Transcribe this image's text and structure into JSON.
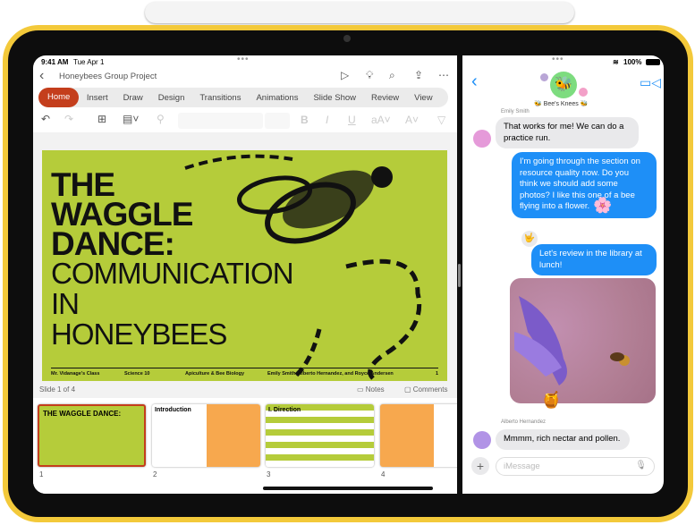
{
  "left_app": {
    "status_time": "9:41 AM",
    "status_date": "Tue Apr 1",
    "doc_title": "Honeybees Group Project",
    "tabs": [
      "Home",
      "Insert",
      "Draw",
      "Design",
      "Transitions",
      "Animations",
      "Slide Show",
      "Review",
      "View"
    ],
    "active_tab": "Home",
    "slide": {
      "title_bold": [
        "THE",
        "WAGGLE",
        "DANCE:"
      ],
      "title_thin": [
        "COMMUNICATION",
        "IN",
        "HONEYBEES"
      ],
      "footer": [
        "Mr. Vidanage's Class",
        "Science 10",
        "Apiculture & Bee Biology",
        "Emily Smith, Alberto Hernandez, and Royce Andersen",
        "1"
      ]
    },
    "slide_counter": "Slide 1 of 4",
    "notes_label": "Notes",
    "comments_label": "Comments",
    "thumbnails": [
      {
        "number": "1",
        "title": "THE WAGGLE DANCE:"
      },
      {
        "number": "2",
        "title": "Introduction"
      },
      {
        "number": "3",
        "title": "I. Direction"
      },
      {
        "number": "4",
        "title": ""
      }
    ],
    "accent": "#c43e1c",
    "slide_color": "#b5cc3a"
  },
  "right_app": {
    "battery": "100%",
    "group_name": "🐝 Bee's Knees 🐝",
    "messages": [
      {
        "sender": "Emily Smith",
        "text": "That works for me! We can do a practice run.",
        "direction": "in"
      },
      {
        "text": "I'm going through the section on resource quality now. Do you think we should add some photos? I like this one of a bee flying into a flower.",
        "direction": "out",
        "tapback": "🌸"
      },
      {
        "text": "Let's review in the library at lunch!",
        "direction": "out",
        "tapback": "🤟"
      },
      {
        "type": "photo",
        "direction": "out"
      },
      {
        "sender": "Alberto Hernandez",
        "text": "Mmmm, rich nectar and pollen.",
        "direction": "in"
      }
    ],
    "input_placeholder": "iMessage",
    "bubble_color": "#1e8ff7"
  }
}
